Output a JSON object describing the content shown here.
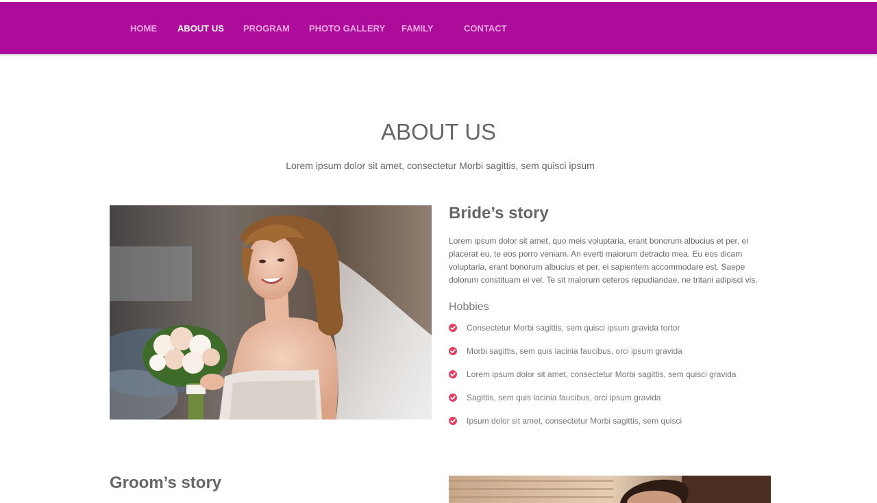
{
  "nav": {
    "items": [
      {
        "label": "HOME",
        "active": false
      },
      {
        "label": "ABOUT US",
        "active": true
      },
      {
        "label": "PROGRAM",
        "active": false
      },
      {
        "label": "PHOTO GALLERY",
        "active": false
      },
      {
        "label": "FAMILY",
        "active": false
      },
      {
        "label": "CONTACT",
        "active": false
      }
    ]
  },
  "section": {
    "title": "ABOUT US",
    "subtitle": "Lorem ipsum dolor sit amet, consectetur Morbi sagittis, sem quisci ipsum"
  },
  "bride": {
    "heading": "Bride’s story",
    "text": "Lorem ipsum dolor sit amet, quo meis voluptaria, erant bonorum albucius et per, ei placerat eu, te eos porro veniam. An everti maiorum detracto mea. Eu eos dicam voluptaria, erant bonorum albucius et per, ei sapientem accommodare est. Saepe dolorum constituam ei vel. Te sit malorum ceteros repudiandae, ne tritani adipisci vis.",
    "hobbies_heading": "Hobbies",
    "hobbies": [
      "Consectetur Morbi sagittis, sem quisci ipsum gravida tortor",
      "Morbi sagittis, sem quis lacinia faucibus, orci ipsum gravida",
      "Lorem ipsum dolor sit amet, consectetur Morbi sagittis, sem quisci gravida",
      "Sagittis, sem quis lacinia faucibus, orci ipsum gravida",
      "Ipsum dolor sit amet, consectetur Morbi sagittis, sem quisci"
    ]
  },
  "groom": {
    "heading": "Groom’s story"
  },
  "colors": {
    "nav_background": "#ac0c99",
    "nav_active": "#ffffff",
    "nav_inactive": "#e9a6e0",
    "check_icon": "#e53e63"
  },
  "icons": {
    "hobby_bullet": "check-circle-icon"
  }
}
